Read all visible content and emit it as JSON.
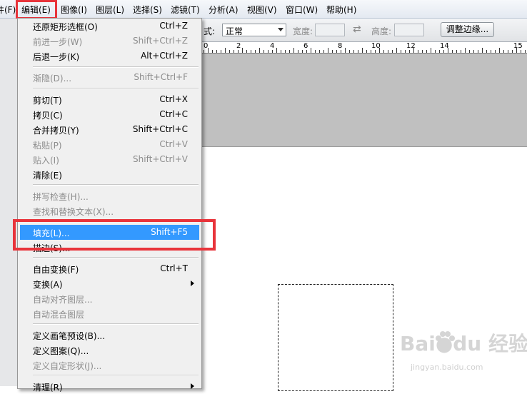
{
  "menubar": {
    "items": [
      {
        "label": "件(F)"
      },
      {
        "label": "编辑(E)"
      },
      {
        "label": "图像(I)"
      },
      {
        "label": "图层(L)"
      },
      {
        "label": "选择(S)"
      },
      {
        "label": "滤镜(T)"
      },
      {
        "label": "分析(A)"
      },
      {
        "label": "视图(V)"
      },
      {
        "label": "窗口(W)"
      },
      {
        "label": "帮助(H)"
      }
    ]
  },
  "options": {
    "style_suffix": "式:",
    "style_value": "正常",
    "width_label": "宽度:",
    "swap_glyph": "⇄",
    "height_label": "高度:",
    "refine_button": "调整边缘..."
  },
  "ruler": {
    "labels": [
      "0",
      "2",
      "4",
      "6",
      "8",
      "10",
      "12",
      "14",
      "15"
    ]
  },
  "edit_menu": {
    "items": [
      {
        "label": "还原矩形选框(O)",
        "shortcut": "Ctrl+Z",
        "disabled": false
      },
      {
        "label": "前进一步(W)",
        "shortcut": "Shift+Ctrl+Z",
        "disabled": true
      },
      {
        "label": "后退一步(K)",
        "shortcut": "Alt+Ctrl+Z",
        "disabled": false
      },
      {
        "label": "渐隐(D)...",
        "shortcut": "Shift+Ctrl+F",
        "disabled": true
      },
      {
        "label": "剪切(T)",
        "shortcut": "Ctrl+X",
        "disabled": false
      },
      {
        "label": "拷贝(C)",
        "shortcut": "Ctrl+C",
        "disabled": false
      },
      {
        "label": "合并拷贝(Y)",
        "shortcut": "Shift+Ctrl+C",
        "disabled": false
      },
      {
        "label": "粘贴(P)",
        "shortcut": "Ctrl+V",
        "disabled": true
      },
      {
        "label": "贴入(I)",
        "shortcut": "Shift+Ctrl+V",
        "disabled": true
      },
      {
        "label": "清除(E)",
        "shortcut": "",
        "disabled": false
      },
      {
        "label": "拼写检查(H)...",
        "shortcut": "",
        "disabled": true
      },
      {
        "label": "查找和替换文本(X)...",
        "shortcut": "",
        "disabled": true
      },
      {
        "label": "填充(L)...",
        "shortcut": "Shift+F5",
        "disabled": false,
        "active": true
      },
      {
        "label": "描边(S)...",
        "shortcut": "",
        "disabled": false
      },
      {
        "label": "自由变换(F)",
        "shortcut": "Ctrl+T",
        "disabled": false
      },
      {
        "label": "变换(A)",
        "shortcut": "",
        "disabled": false
      },
      {
        "label": "自动对齐图层...",
        "shortcut": "",
        "disabled": true
      },
      {
        "label": "自动混合图层",
        "shortcut": "",
        "disabled": true
      },
      {
        "label": "定义画笔预设(B)...",
        "shortcut": "",
        "disabled": false
      },
      {
        "label": "定义图案(Q)...",
        "shortcut": "",
        "disabled": false
      },
      {
        "label": "定义自定形状(J)...",
        "shortcut": "",
        "disabled": true
      },
      {
        "label": "清理(R)",
        "shortcut": "",
        "disabled": false
      }
    ]
  },
  "watermark": {
    "brand": "Bai●du 经验",
    "url": "jingyan.baidu.com"
  },
  "colors": {
    "highlight_red": "#e8343b",
    "menu_active_blue": "#3399ff"
  }
}
